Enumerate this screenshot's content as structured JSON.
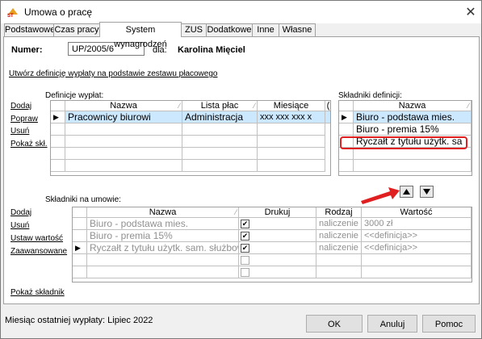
{
  "window": {
    "title": "Umowa o pracę",
    "close_symbol": "✕"
  },
  "tabs": [
    "Podstawowe",
    "Czas pracy",
    "System wynagrodzeń",
    "ZUS",
    "Dodatkowe",
    "Inne",
    "Własne"
  ],
  "header": {
    "numer_label": "Numer:",
    "numer_value": "UP/2005/6",
    "dla_label": "dla:",
    "dla_value": "Karolina Mięciel"
  },
  "create_link": "Utwórz definicję wypłaty na podstawie zestawu płacowego",
  "definicje": {
    "label": "Definicje wypłat:",
    "actions": [
      "Dodaj",
      "Popraw",
      "Usuń",
      "Pokaż skł."
    ],
    "columns": [
      "Nazwa",
      "Lista płac",
      "Miesiące",
      "("
    ],
    "rows": [
      {
        "marker": "▶",
        "nazwa": "Pracownicy biurowi",
        "lista": "Administracja",
        "miesiace": "xxx xxx xxx x"
      }
    ]
  },
  "skladniki_def": {
    "label": "Składniki definicji:",
    "columns": [
      "Nazwa"
    ],
    "rows": [
      {
        "marker": "▶",
        "nazwa": "Biuro - podstawa mies."
      },
      {
        "marker": "",
        "nazwa": "Biuro - premia 15%"
      },
      {
        "marker": "",
        "nazwa": "Ryczałt z tytułu użytk. sa"
      }
    ],
    "up_icon": "▲",
    "down_icon": "▼"
  },
  "skladniki_umowa": {
    "label": "Składniki na umowie:",
    "actions": [
      "Dodaj",
      "Usuń",
      "Ustaw wartość",
      "Zaawansowane"
    ],
    "bottom_link": "Pokaż składnik",
    "columns": [
      "Nazwa",
      "Drukuj",
      "Rodzaj",
      "Wartość"
    ],
    "rows": [
      {
        "marker": "",
        "nazwa": "Biuro - podstawa mies.",
        "drukuj": true,
        "rodzaj": "naliczenie",
        "wartosc": "3000 zł"
      },
      {
        "marker": "",
        "nazwa": "Biuro - premia 15%",
        "drukuj": true,
        "rodzaj": "naliczenie",
        "wartosc": "<<definicja>>"
      },
      {
        "marker": "▶",
        "nazwa": "Ryczałt z tytułu użytk. sam. służbow",
        "drukuj": true,
        "rodzaj": "naliczenie",
        "wartosc": "<<definicja>>"
      },
      {
        "marker": "",
        "nazwa": "",
        "drukuj": false,
        "rodzaj": "",
        "wartosc": ""
      },
      {
        "marker": "",
        "nazwa": "",
        "drukuj": false,
        "rodzaj": "",
        "wartosc": ""
      }
    ]
  },
  "status": "Miesiąc ostatniej wypłaty: Lipiec 2022",
  "buttons": {
    "ok": "OK",
    "cancel": "Anuluj",
    "help": "Pomoc"
  },
  "colors": {
    "selection": "#cce8ff",
    "highlight_border": "#e02020",
    "arrow": "#e02020"
  }
}
